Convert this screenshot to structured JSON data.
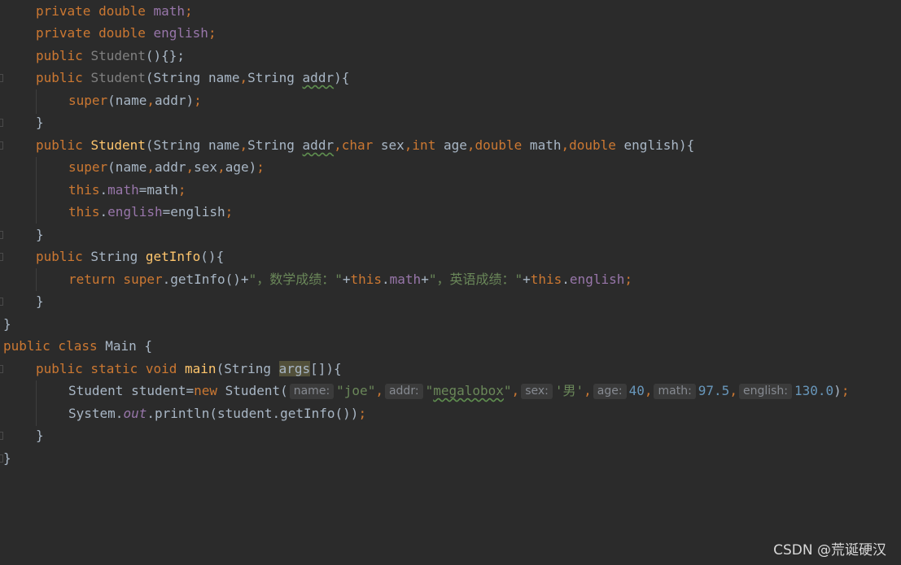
{
  "editor": {
    "line1": {
      "kw": "private double",
      "fld": "math",
      "semi": ";"
    },
    "line2": {
      "kw": "private double",
      "fld": "english",
      "semi": ";"
    },
    "line3": {
      "kw": "public",
      "name": "Student",
      "rest": "(){};"
    },
    "line4": {
      "kw": "public",
      "name": "Student",
      "open": "(String name",
      "comma": ",",
      "mid": "String ",
      "addr": "addr",
      "close": "){"
    },
    "line5": {
      "kw": "super",
      "args": "(name",
      "comma": ",",
      "rest": "addr)",
      "semi": ";"
    },
    "line6": {
      "text": "}"
    },
    "line7": {
      "kw": "public",
      "fn": "Student",
      "p1": "(String name",
      "c1": ",",
      "p2": "String ",
      "addr": "addr",
      "c2": ",",
      "t3": "char",
      "p3": " sex",
      "c3": ",",
      "t4": "int",
      "p4": " age",
      "c4": ",",
      "t5": "double",
      "p5": " math",
      "c5": ",",
      "t6": "double",
      "p6": " english){"
    },
    "line8": {
      "kw": "super",
      "a1": "(name",
      "c1": ",",
      "a2": "addr",
      "c2": ",",
      "a3": "sex",
      "c3": ",",
      "a4": "age)",
      "semi": ";"
    },
    "line9": {
      "kw": "this",
      "dot": ".",
      "fld": "math",
      "rest": "=math",
      "semi": ";"
    },
    "line10": {
      "kw": "this",
      "dot": ".",
      "fld": "english",
      "rest": "=english",
      "semi": ";"
    },
    "line11": {
      "text": "}"
    },
    "line12": {
      "kw": "public",
      "type": " String ",
      "fn": "getInfo",
      "rest": "(){"
    },
    "line13": {
      "kw": "return super",
      "m": ".getInfo()+",
      "s1": "\"，数学成绩：\"",
      "p1": "+",
      "this1": "this",
      "d1": ".",
      "f1": "math",
      "p2": "+",
      "s2": "\"，英语成绩：\"",
      "p3": "+",
      "this2": "this",
      "d2": ".",
      "f2": "english",
      "semi": ";"
    },
    "line14": {
      "text": "}"
    },
    "line15": {
      "text": "}"
    },
    "line16": {
      "kw": "public class",
      "rest": " Main {"
    },
    "line17": {
      "kw": "public static void",
      "fn": "main",
      "open": "(String ",
      "args": "args",
      "close": "[]){"
    },
    "line18": {
      "t1": "Student student=",
      "kw": "new",
      "t2": " Student(",
      "h1": "name:",
      "s1": "\"joe\"",
      "c1": ",",
      "h2": "addr:",
      "s2q1": "\"",
      "s2": "megalobox",
      "s2q2": "\"",
      "c2": ",",
      "h3": "sex:",
      "s3": "'男'",
      "c3": ",",
      "h4": "age:",
      "n4": "40",
      "c4": ",",
      "h5": "math:",
      "n5": "97.5",
      "c5": ",",
      "h6": "english:",
      "n6": "130.0",
      "close": ")",
      "semi": ";"
    },
    "line19": {
      "t1": "System.",
      "out": "out",
      "t2": ".println(student.getInfo())",
      "semi": ";"
    },
    "line20": {
      "text": "}"
    },
    "line21": {
      "text": "}"
    }
  },
  "watermark": "CSDN @荒诞硬汉"
}
